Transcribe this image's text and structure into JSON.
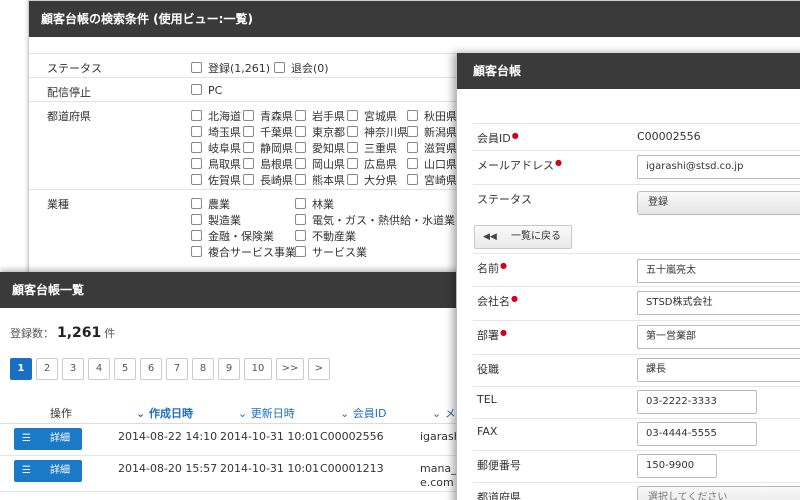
{
  "search": {
    "title": "顧客台帳の検索条件 (使用ビュー:一覧)",
    "status_label": "ステータス",
    "status_options": [
      "登録(1,261)",
      "退会(0)"
    ],
    "optout_label": "配信停止",
    "optout_options": [
      "PC"
    ],
    "pref_label": "都道府県",
    "prefectures": [
      [
        "北海道",
        "青森県",
        "岩手県",
        "宮城県",
        "秋田県"
      ],
      [
        "埼玉県",
        "千葉県",
        "東京都",
        "神奈川県",
        "新潟県"
      ],
      [
        "岐阜県",
        "静岡県",
        "愛知県",
        "三重県",
        "滋賀県"
      ],
      [
        "鳥取県",
        "島根県",
        "岡山県",
        "広島県",
        "山口県"
      ],
      [
        "佐賀県",
        "長崎県",
        "熊本県",
        "大分県",
        "宮崎県"
      ]
    ],
    "industry_label": "業種",
    "industries": [
      [
        "農業",
        "林業"
      ],
      [
        "製造業",
        "電気・ガス・熱供給・水道業"
      ],
      [
        "金融・保険業",
        "不動産業"
      ],
      [
        "複合サービス事業",
        "サービス業"
      ]
    ]
  },
  "list": {
    "title": "顧客台帳一覧",
    "count_label": "登録数：",
    "count_value": "1,261",
    "count_unit": "件",
    "pages": [
      "1",
      "2",
      "3",
      "4",
      "5",
      "6",
      "7",
      "8",
      "9",
      "10",
      ">>",
      ">"
    ],
    "active_page": "1",
    "columns": [
      "操作",
      "作成日時",
      "更新日時",
      "会員ID",
      "メ"
    ],
    "detail_button": "詳細",
    "rows": [
      {
        "created": "2014-08-22 14:10",
        "updated": "2014-10-31 10:01",
        "member_id": "C00002556",
        "email": "igarashi"
      },
      {
        "created": "2014-08-20 15:57",
        "updated": "2014-10-31 10:01",
        "member_id": "C00001213",
        "email": "mana_k",
        "email2": "e.com"
      }
    ]
  },
  "detail": {
    "title": "顧客台帳",
    "member_id_label": "会員ID",
    "member_id": "C00002556",
    "email_label": "メールアドレス",
    "email": "igarashi@stsd.co.jp",
    "status_label": "ステータス",
    "status": "登録",
    "back_button": "一覧に戻る",
    "name_label": "名前",
    "name": "五十嵐亮太",
    "company_label": "会社名",
    "company": "STSD株式会社",
    "dept_label": "部署",
    "dept": "第一営業部",
    "position_label": "役職",
    "position": "課長",
    "tel_label": "TEL",
    "tel": "03-2222-3333",
    "fax_label": "FAX",
    "fax": "03-4444-5555",
    "zip_label": "郵便番号",
    "zip": "150-9900",
    "pref_label": "都道府県",
    "pref_placeholder": "選択してください"
  },
  "colors": {
    "header": "#3a3a3a",
    "accent": "#1b6fc0",
    "required": "#d0021b"
  }
}
